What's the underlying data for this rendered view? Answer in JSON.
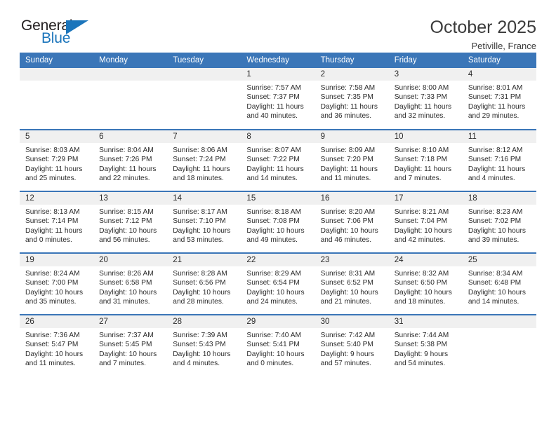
{
  "brand": {
    "name_part1": "General",
    "name_part2": "Blue",
    "accent_color": "#1b75bb"
  },
  "header": {
    "month_title": "October 2025",
    "location": "Petiville, France",
    "header_bg": "#3b76b8"
  },
  "weekday_headers": [
    "Sunday",
    "Monday",
    "Tuesday",
    "Wednesday",
    "Thursday",
    "Friday",
    "Saturday"
  ],
  "labels": {
    "sunrise_prefix": "Sunrise:",
    "sunset_prefix": "Sunset:",
    "daylight_prefix": "Daylight:"
  },
  "weeks": [
    [
      {
        "day": "",
        "line1": "",
        "line2": "",
        "line3": "",
        "line4": "",
        "empty": true
      },
      {
        "day": "",
        "line1": "",
        "line2": "",
        "line3": "",
        "line4": "",
        "empty": true
      },
      {
        "day": "",
        "line1": "",
        "line2": "",
        "line3": "",
        "line4": "",
        "empty": true
      },
      {
        "day": "1",
        "line1": "Sunrise: 7:57 AM",
        "line2": "Sunset: 7:37 PM",
        "line3": "Daylight: 11 hours",
        "line4": "and 40 minutes.",
        "empty": false
      },
      {
        "day": "2",
        "line1": "Sunrise: 7:58 AM",
        "line2": "Sunset: 7:35 PM",
        "line3": "Daylight: 11 hours",
        "line4": "and 36 minutes.",
        "empty": false
      },
      {
        "day": "3",
        "line1": "Sunrise: 8:00 AM",
        "line2": "Sunset: 7:33 PM",
        "line3": "Daylight: 11 hours",
        "line4": "and 32 minutes.",
        "empty": false
      },
      {
        "day": "4",
        "line1": "Sunrise: 8:01 AM",
        "line2": "Sunset: 7:31 PM",
        "line3": "Daylight: 11 hours",
        "line4": "and 29 minutes.",
        "empty": false
      }
    ],
    [
      {
        "day": "5",
        "line1": "Sunrise: 8:03 AM",
        "line2": "Sunset: 7:29 PM",
        "line3": "Daylight: 11 hours",
        "line4": "and 25 minutes.",
        "empty": false
      },
      {
        "day": "6",
        "line1": "Sunrise: 8:04 AM",
        "line2": "Sunset: 7:26 PM",
        "line3": "Daylight: 11 hours",
        "line4": "and 22 minutes.",
        "empty": false
      },
      {
        "day": "7",
        "line1": "Sunrise: 8:06 AM",
        "line2": "Sunset: 7:24 PM",
        "line3": "Daylight: 11 hours",
        "line4": "and 18 minutes.",
        "empty": false
      },
      {
        "day": "8",
        "line1": "Sunrise: 8:07 AM",
        "line2": "Sunset: 7:22 PM",
        "line3": "Daylight: 11 hours",
        "line4": "and 14 minutes.",
        "empty": false
      },
      {
        "day": "9",
        "line1": "Sunrise: 8:09 AM",
        "line2": "Sunset: 7:20 PM",
        "line3": "Daylight: 11 hours",
        "line4": "and 11 minutes.",
        "empty": false
      },
      {
        "day": "10",
        "line1": "Sunrise: 8:10 AM",
        "line2": "Sunset: 7:18 PM",
        "line3": "Daylight: 11 hours",
        "line4": "and 7 minutes.",
        "empty": false
      },
      {
        "day": "11",
        "line1": "Sunrise: 8:12 AM",
        "line2": "Sunset: 7:16 PM",
        "line3": "Daylight: 11 hours",
        "line4": "and 4 minutes.",
        "empty": false
      }
    ],
    [
      {
        "day": "12",
        "line1": "Sunrise: 8:13 AM",
        "line2": "Sunset: 7:14 PM",
        "line3": "Daylight: 11 hours",
        "line4": "and 0 minutes.",
        "empty": false
      },
      {
        "day": "13",
        "line1": "Sunrise: 8:15 AM",
        "line2": "Sunset: 7:12 PM",
        "line3": "Daylight: 10 hours",
        "line4": "and 56 minutes.",
        "empty": false
      },
      {
        "day": "14",
        "line1": "Sunrise: 8:17 AM",
        "line2": "Sunset: 7:10 PM",
        "line3": "Daylight: 10 hours",
        "line4": "and 53 minutes.",
        "empty": false
      },
      {
        "day": "15",
        "line1": "Sunrise: 8:18 AM",
        "line2": "Sunset: 7:08 PM",
        "line3": "Daylight: 10 hours",
        "line4": "and 49 minutes.",
        "empty": false
      },
      {
        "day": "16",
        "line1": "Sunrise: 8:20 AM",
        "line2": "Sunset: 7:06 PM",
        "line3": "Daylight: 10 hours",
        "line4": "and 46 minutes.",
        "empty": false
      },
      {
        "day": "17",
        "line1": "Sunrise: 8:21 AM",
        "line2": "Sunset: 7:04 PM",
        "line3": "Daylight: 10 hours",
        "line4": "and 42 minutes.",
        "empty": false
      },
      {
        "day": "18",
        "line1": "Sunrise: 8:23 AM",
        "line2": "Sunset: 7:02 PM",
        "line3": "Daylight: 10 hours",
        "line4": "and 39 minutes.",
        "empty": false
      }
    ],
    [
      {
        "day": "19",
        "line1": "Sunrise: 8:24 AM",
        "line2": "Sunset: 7:00 PM",
        "line3": "Daylight: 10 hours",
        "line4": "and 35 minutes.",
        "empty": false
      },
      {
        "day": "20",
        "line1": "Sunrise: 8:26 AM",
        "line2": "Sunset: 6:58 PM",
        "line3": "Daylight: 10 hours",
        "line4": "and 31 minutes.",
        "empty": false
      },
      {
        "day": "21",
        "line1": "Sunrise: 8:28 AM",
        "line2": "Sunset: 6:56 PM",
        "line3": "Daylight: 10 hours",
        "line4": "and 28 minutes.",
        "empty": false
      },
      {
        "day": "22",
        "line1": "Sunrise: 8:29 AM",
        "line2": "Sunset: 6:54 PM",
        "line3": "Daylight: 10 hours",
        "line4": "and 24 minutes.",
        "empty": false
      },
      {
        "day": "23",
        "line1": "Sunrise: 8:31 AM",
        "line2": "Sunset: 6:52 PM",
        "line3": "Daylight: 10 hours",
        "line4": "and 21 minutes.",
        "empty": false
      },
      {
        "day": "24",
        "line1": "Sunrise: 8:32 AM",
        "line2": "Sunset: 6:50 PM",
        "line3": "Daylight: 10 hours",
        "line4": "and 18 minutes.",
        "empty": false
      },
      {
        "day": "25",
        "line1": "Sunrise: 8:34 AM",
        "line2": "Sunset: 6:48 PM",
        "line3": "Daylight: 10 hours",
        "line4": "and 14 minutes.",
        "empty": false
      }
    ],
    [
      {
        "day": "26",
        "line1": "Sunrise: 7:36 AM",
        "line2": "Sunset: 5:47 PM",
        "line3": "Daylight: 10 hours",
        "line4": "and 11 minutes.",
        "empty": false
      },
      {
        "day": "27",
        "line1": "Sunrise: 7:37 AM",
        "line2": "Sunset: 5:45 PM",
        "line3": "Daylight: 10 hours",
        "line4": "and 7 minutes.",
        "empty": false
      },
      {
        "day": "28",
        "line1": "Sunrise: 7:39 AM",
        "line2": "Sunset: 5:43 PM",
        "line3": "Daylight: 10 hours",
        "line4": "and 4 minutes.",
        "empty": false
      },
      {
        "day": "29",
        "line1": "Sunrise: 7:40 AM",
        "line2": "Sunset: 5:41 PM",
        "line3": "Daylight: 10 hours",
        "line4": "and 0 minutes.",
        "empty": false
      },
      {
        "day": "30",
        "line1": "Sunrise: 7:42 AM",
        "line2": "Sunset: 5:40 PM",
        "line3": "Daylight: 9 hours",
        "line4": "and 57 minutes.",
        "empty": false
      },
      {
        "day": "31",
        "line1": "Sunrise: 7:44 AM",
        "line2": "Sunset: 5:38 PM",
        "line3": "Daylight: 9 hours",
        "line4": "and 54 minutes.",
        "empty": false
      },
      {
        "day": "",
        "line1": "",
        "line2": "",
        "line3": "",
        "line4": "",
        "empty": true
      }
    ]
  ]
}
